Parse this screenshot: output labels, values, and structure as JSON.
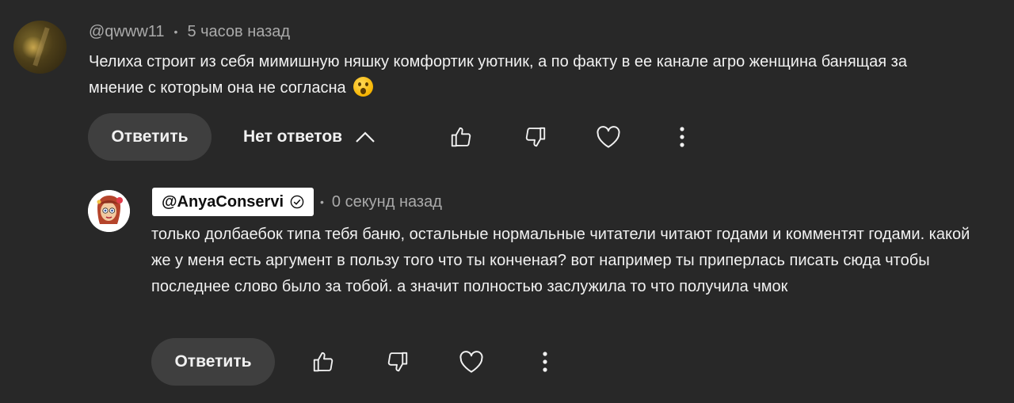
{
  "comment1": {
    "author": "@qwww11",
    "separator": "•",
    "time": "5 часов назад",
    "text": "Челиха строит из себя мимишную няшку комфортик уютник, а по факту в ее канале агро женщина банящая за мнение с которым она не согласна",
    "emoji": "surprised-face",
    "reply_label": "Ответить",
    "replies_label": "Нет ответов"
  },
  "comment2": {
    "author": "@AnyaConservi",
    "separator": "•",
    "time": "0 секунд назад",
    "text": "только долбаебок типа тебя баню, остальные нормальные читатели читают годами и комментят годами. какой же у меня есть аргумент в пользу того что ты конченая? вот например ты приперлась писать сюда чтобы последнее слово было за тобой. а значит полностью заслужила то что получила чмок",
    "reply_label": "Ответить"
  },
  "icons": {
    "like": "thumbs-up-icon",
    "dislike": "thumbs-down-icon",
    "heart": "heart-icon",
    "more": "more-vertical-icon",
    "chevron": "chevron-up-icon",
    "verified": "verified-check-icon"
  },
  "colors": {
    "background": "#282828",
    "button_bg": "#3f3f3f",
    "text_primary": "#f1f1f1",
    "text_secondary": "#aaaaaa"
  }
}
